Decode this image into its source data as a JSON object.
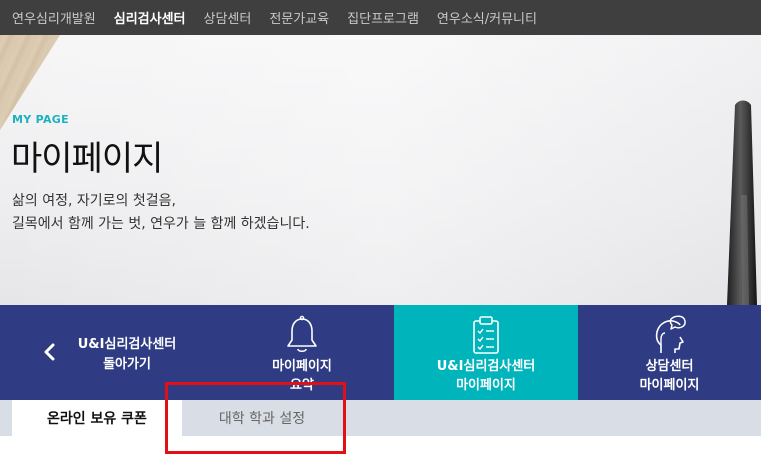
{
  "topnav": {
    "items": [
      {
        "label": "연우심리개발원",
        "active": false
      },
      {
        "label": "심리검사센터",
        "active": true
      },
      {
        "label": "상담센터",
        "active": false
      },
      {
        "label": "전문가교육",
        "active": false
      },
      {
        "label": "집단프로그램",
        "active": false
      },
      {
        "label": "연우소식/커뮤니티",
        "active": false
      }
    ]
  },
  "hero": {
    "eyebrow": "MY PAGE",
    "title": "마이페이지",
    "desc_line1": "삶의 여정, 자기로의 첫걸음,",
    "desc_line2": "길목에서 함께 가는 벗, 연우가 늘 함께 하겠습니다."
  },
  "menubar": {
    "back": {
      "line1": "U&I심리검사센터",
      "line2": "돌아가기",
      "icon": "chevron-left-icon"
    },
    "mypage": {
      "line1": "마이페이지",
      "line2": "요약",
      "icon": "bell-icon"
    },
    "center": {
      "line1": "U&I심리검사센터",
      "line2": "마이페이지",
      "icon": "clipboard-checklist-icon",
      "active": true
    },
    "counsel": {
      "line1": "상담센터",
      "line2": "마이페이지",
      "icon": "head-speech-icon"
    }
  },
  "tabs": [
    {
      "label": "온라인 보유 쿠폰",
      "active": true
    },
    {
      "label": "대학 학과 설정",
      "active": false
    }
  ],
  "colors": {
    "topnav_bg": "#3f3f3f",
    "accent_teal": "#00b4bc",
    "menubar_navy": "#2f3c84",
    "tabs_bg": "#d9dde6",
    "highlight_red": "#e30f16"
  }
}
